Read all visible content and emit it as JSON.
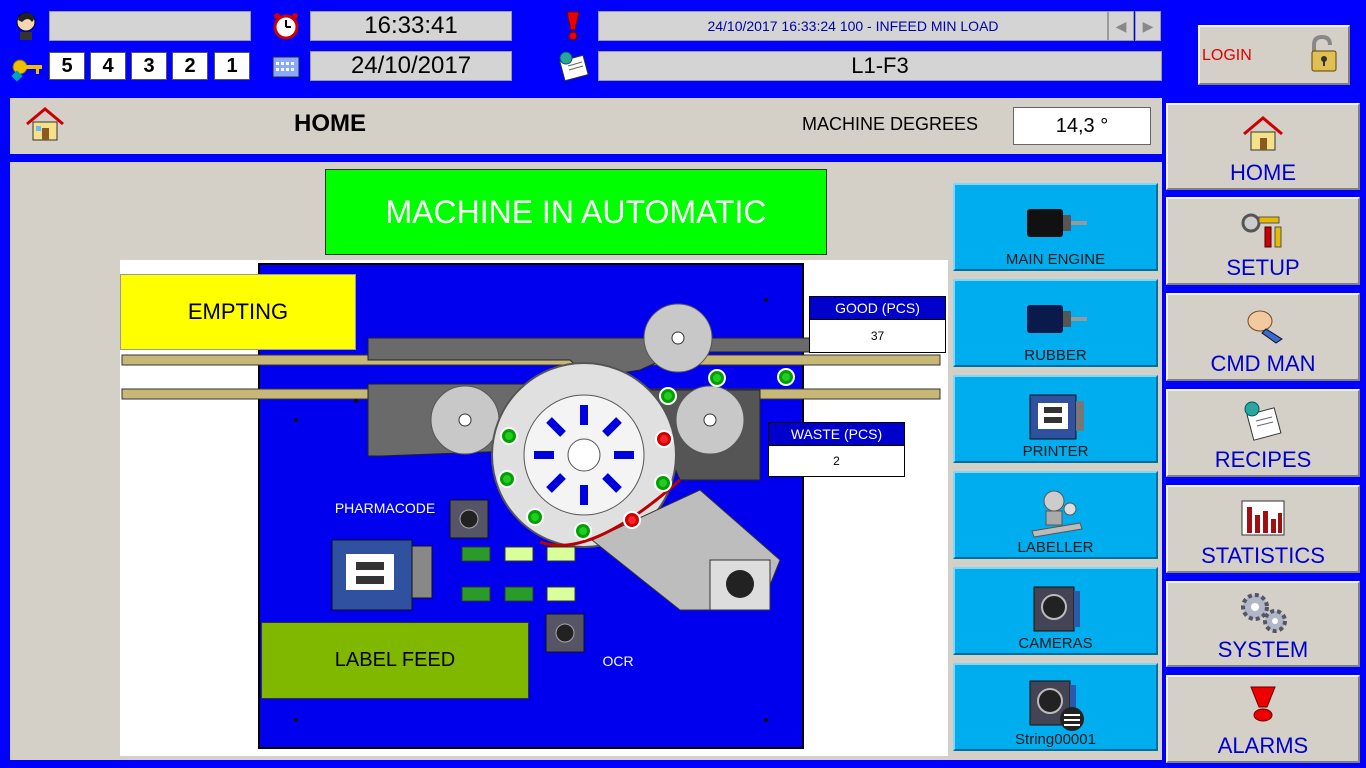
{
  "header": {
    "user_field": "",
    "time": "16:33:41",
    "date": "24/10/2017",
    "alarm_message": "24/10/2017 16:33:24 100 - INFEED MIN LOAD",
    "station": "L1-F3",
    "access_levels": [
      "5",
      "4",
      "3",
      "2",
      "1"
    ],
    "login_label": "LOGIN"
  },
  "title_bar": {
    "page_title": "HOME",
    "degrees_label": "MACHINE DEGREES",
    "degrees_value": "14,3 °"
  },
  "status_banner": "MACHINE IN AUTOMATIC",
  "synoptic": {
    "empting_label": "EMPTING",
    "label_feed_label": "LABEL FEED",
    "pharmacode_label": "PHARMACODE",
    "ocr_label": "OCR",
    "good": {
      "label": "GOOD (PCS)",
      "value": "37"
    },
    "waste": {
      "label": "WASTE (PCS)",
      "value": "2"
    }
  },
  "devices": [
    {
      "label": "MAIN ENGINE",
      "icon": "motor-icon"
    },
    {
      "label": "RUBBER",
      "icon": "motor-icon"
    },
    {
      "label": "PRINTER",
      "icon": "printer-icon"
    },
    {
      "label": "LABELLER",
      "icon": "labeller-icon"
    },
    {
      "label": "CAMERAS",
      "icon": "camera-icon"
    },
    {
      "label": "String00001",
      "icon": "camera-icon"
    }
  ],
  "nav": [
    {
      "label": "HOME",
      "icon": "home-icon"
    },
    {
      "label": "SETUP",
      "icon": "tools-icon"
    },
    {
      "label": "CMD MAN",
      "icon": "hand-icon"
    },
    {
      "label": "RECIPES",
      "icon": "recipe-icon"
    },
    {
      "label": "STATISTICS",
      "icon": "chart-icon"
    },
    {
      "label": "SYSTEM",
      "icon": "gears-icon"
    },
    {
      "label": "ALARMS",
      "icon": "alarm-icon"
    }
  ],
  "colors": {
    "background": "#0000ff",
    "automatic_banner": "#00ff00",
    "device_button": "#00aeef",
    "empting": "#ffff00",
    "label_feed": "#80b800"
  }
}
